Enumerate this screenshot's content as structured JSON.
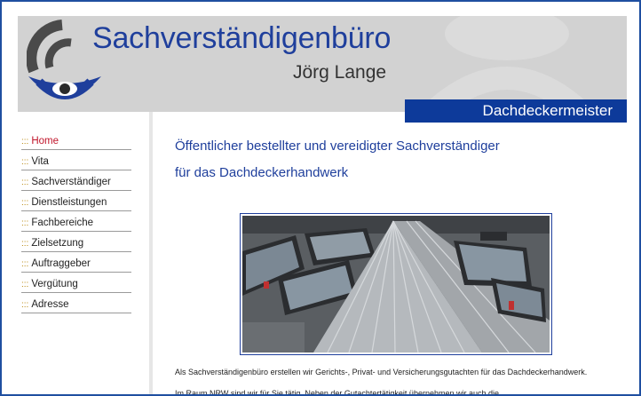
{
  "header": {
    "title": "Sachverständigenbüro",
    "subtitle": "Jörg Lange",
    "profession": "Dachdeckermeister"
  },
  "colors": {
    "brand_blue": "#1f3f9c",
    "bar_blue": "#0d3a9a",
    "header_gray": "#d2d2d2",
    "active_red": "#c0152a"
  },
  "nav": {
    "bullet": ":::",
    "items": [
      {
        "label": "Home",
        "active": true
      },
      {
        "label": "Vita"
      },
      {
        "label": "Sachverständiger"
      },
      {
        "label": "Dienstleistungen"
      },
      {
        "label": "Fachbereiche"
      },
      {
        "label": "Zielsetzung"
      },
      {
        "label": "Auftraggeber"
      },
      {
        "label": "Vergütung"
      },
      {
        "label": "Adresse"
      }
    ]
  },
  "main": {
    "headline1": "Öffentlicher bestellter und vereidigter Sachverständiger",
    "headline2": "für das Dachdeckerhandwerk",
    "paragraph1": "Als Sachverständigenbüro erstellen wir Gerichts-, Privat- und Versicherungsgutachten für das Dachdeckerhandwerk.",
    "paragraph2": "Im Raum NRW sind wir für Sie tätig. Neben der Gutachtertätigkeit übernehmen wir auch die"
  },
  "icons": {
    "logo": "eye-logo-icon",
    "photo": "roof-photo"
  }
}
